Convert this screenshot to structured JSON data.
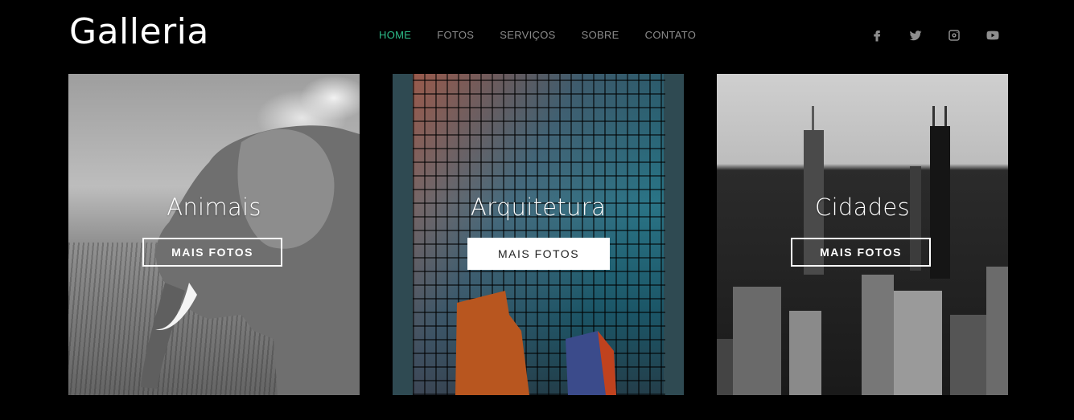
{
  "brand": {
    "logo": "Galleria"
  },
  "nav": {
    "items": [
      {
        "label": "HOME",
        "active": true
      },
      {
        "label": "FOTOS",
        "active": false
      },
      {
        "label": "SERVIÇOS",
        "active": false
      },
      {
        "label": "SOBRE",
        "active": false
      },
      {
        "label": "CONTATO",
        "active": false
      }
    ],
    "active_color": "#2dbd8a",
    "inactive_color": "#8c8c8c"
  },
  "social": [
    "facebook-icon",
    "twitter-icon",
    "instagram-icon",
    "youtube-icon"
  ],
  "cards": [
    {
      "title": "Animais",
      "button": "MAIS FOTOS",
      "image": "elephant-photo"
    },
    {
      "title": "Arquitetura",
      "button": "MAIS FOTOS",
      "image": "glass-building-photo"
    },
    {
      "title": "Cidades",
      "button": "MAIS FOTOS",
      "image": "city-skyline-photo"
    }
  ]
}
